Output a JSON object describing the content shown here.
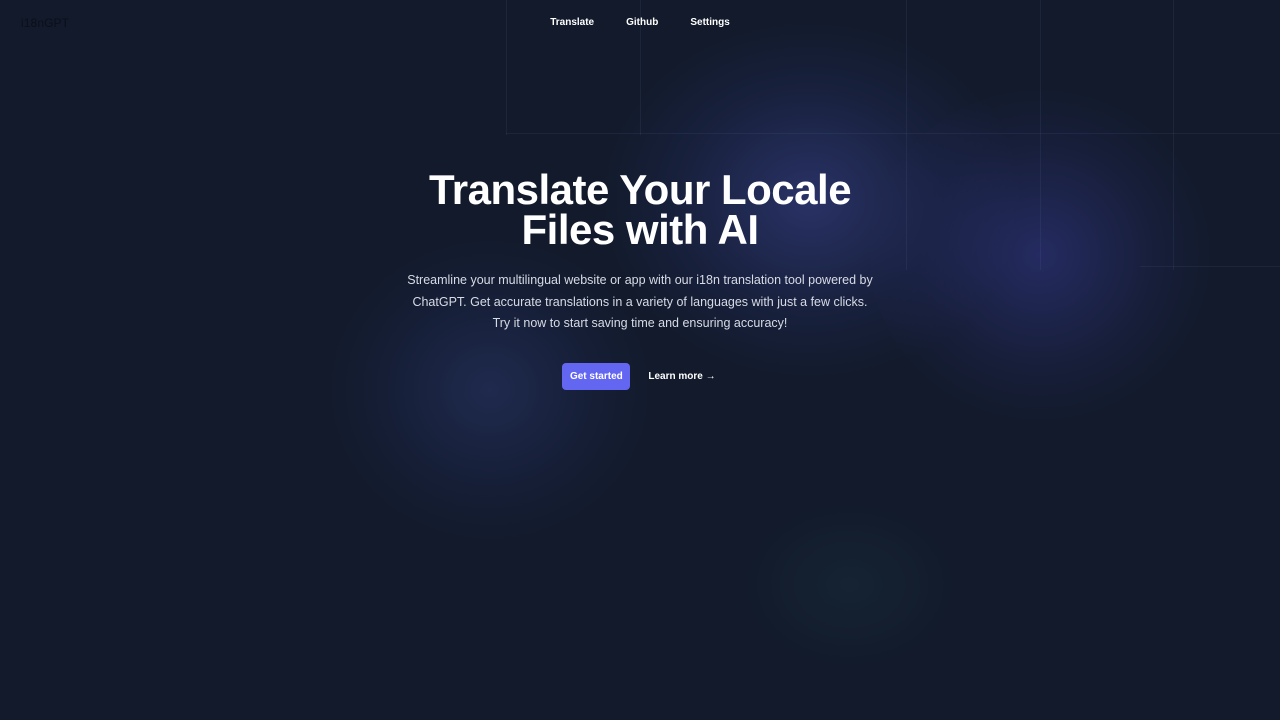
{
  "header": {
    "logo_text": "i18nGPT",
    "nav": [
      {
        "label": "Translate"
      },
      {
        "label": "Github"
      },
      {
        "label": "Settings"
      }
    ]
  },
  "hero": {
    "title_line1": "Translate Your Locale",
    "title_line2": "Files with AI",
    "description": "Streamline your multilingual website or app with our i18n translation tool powered by ChatGPT. Get accurate translations in a variety of languages with just a few clicks. Try it now to start saving time and ensuring accuracy!",
    "primary_label": "Get started",
    "secondary_label": "Learn more",
    "secondary_arrow": "→"
  },
  "colors": {
    "background": "#121a2b",
    "accent": "#6366f1",
    "text": "#ffffff"
  }
}
